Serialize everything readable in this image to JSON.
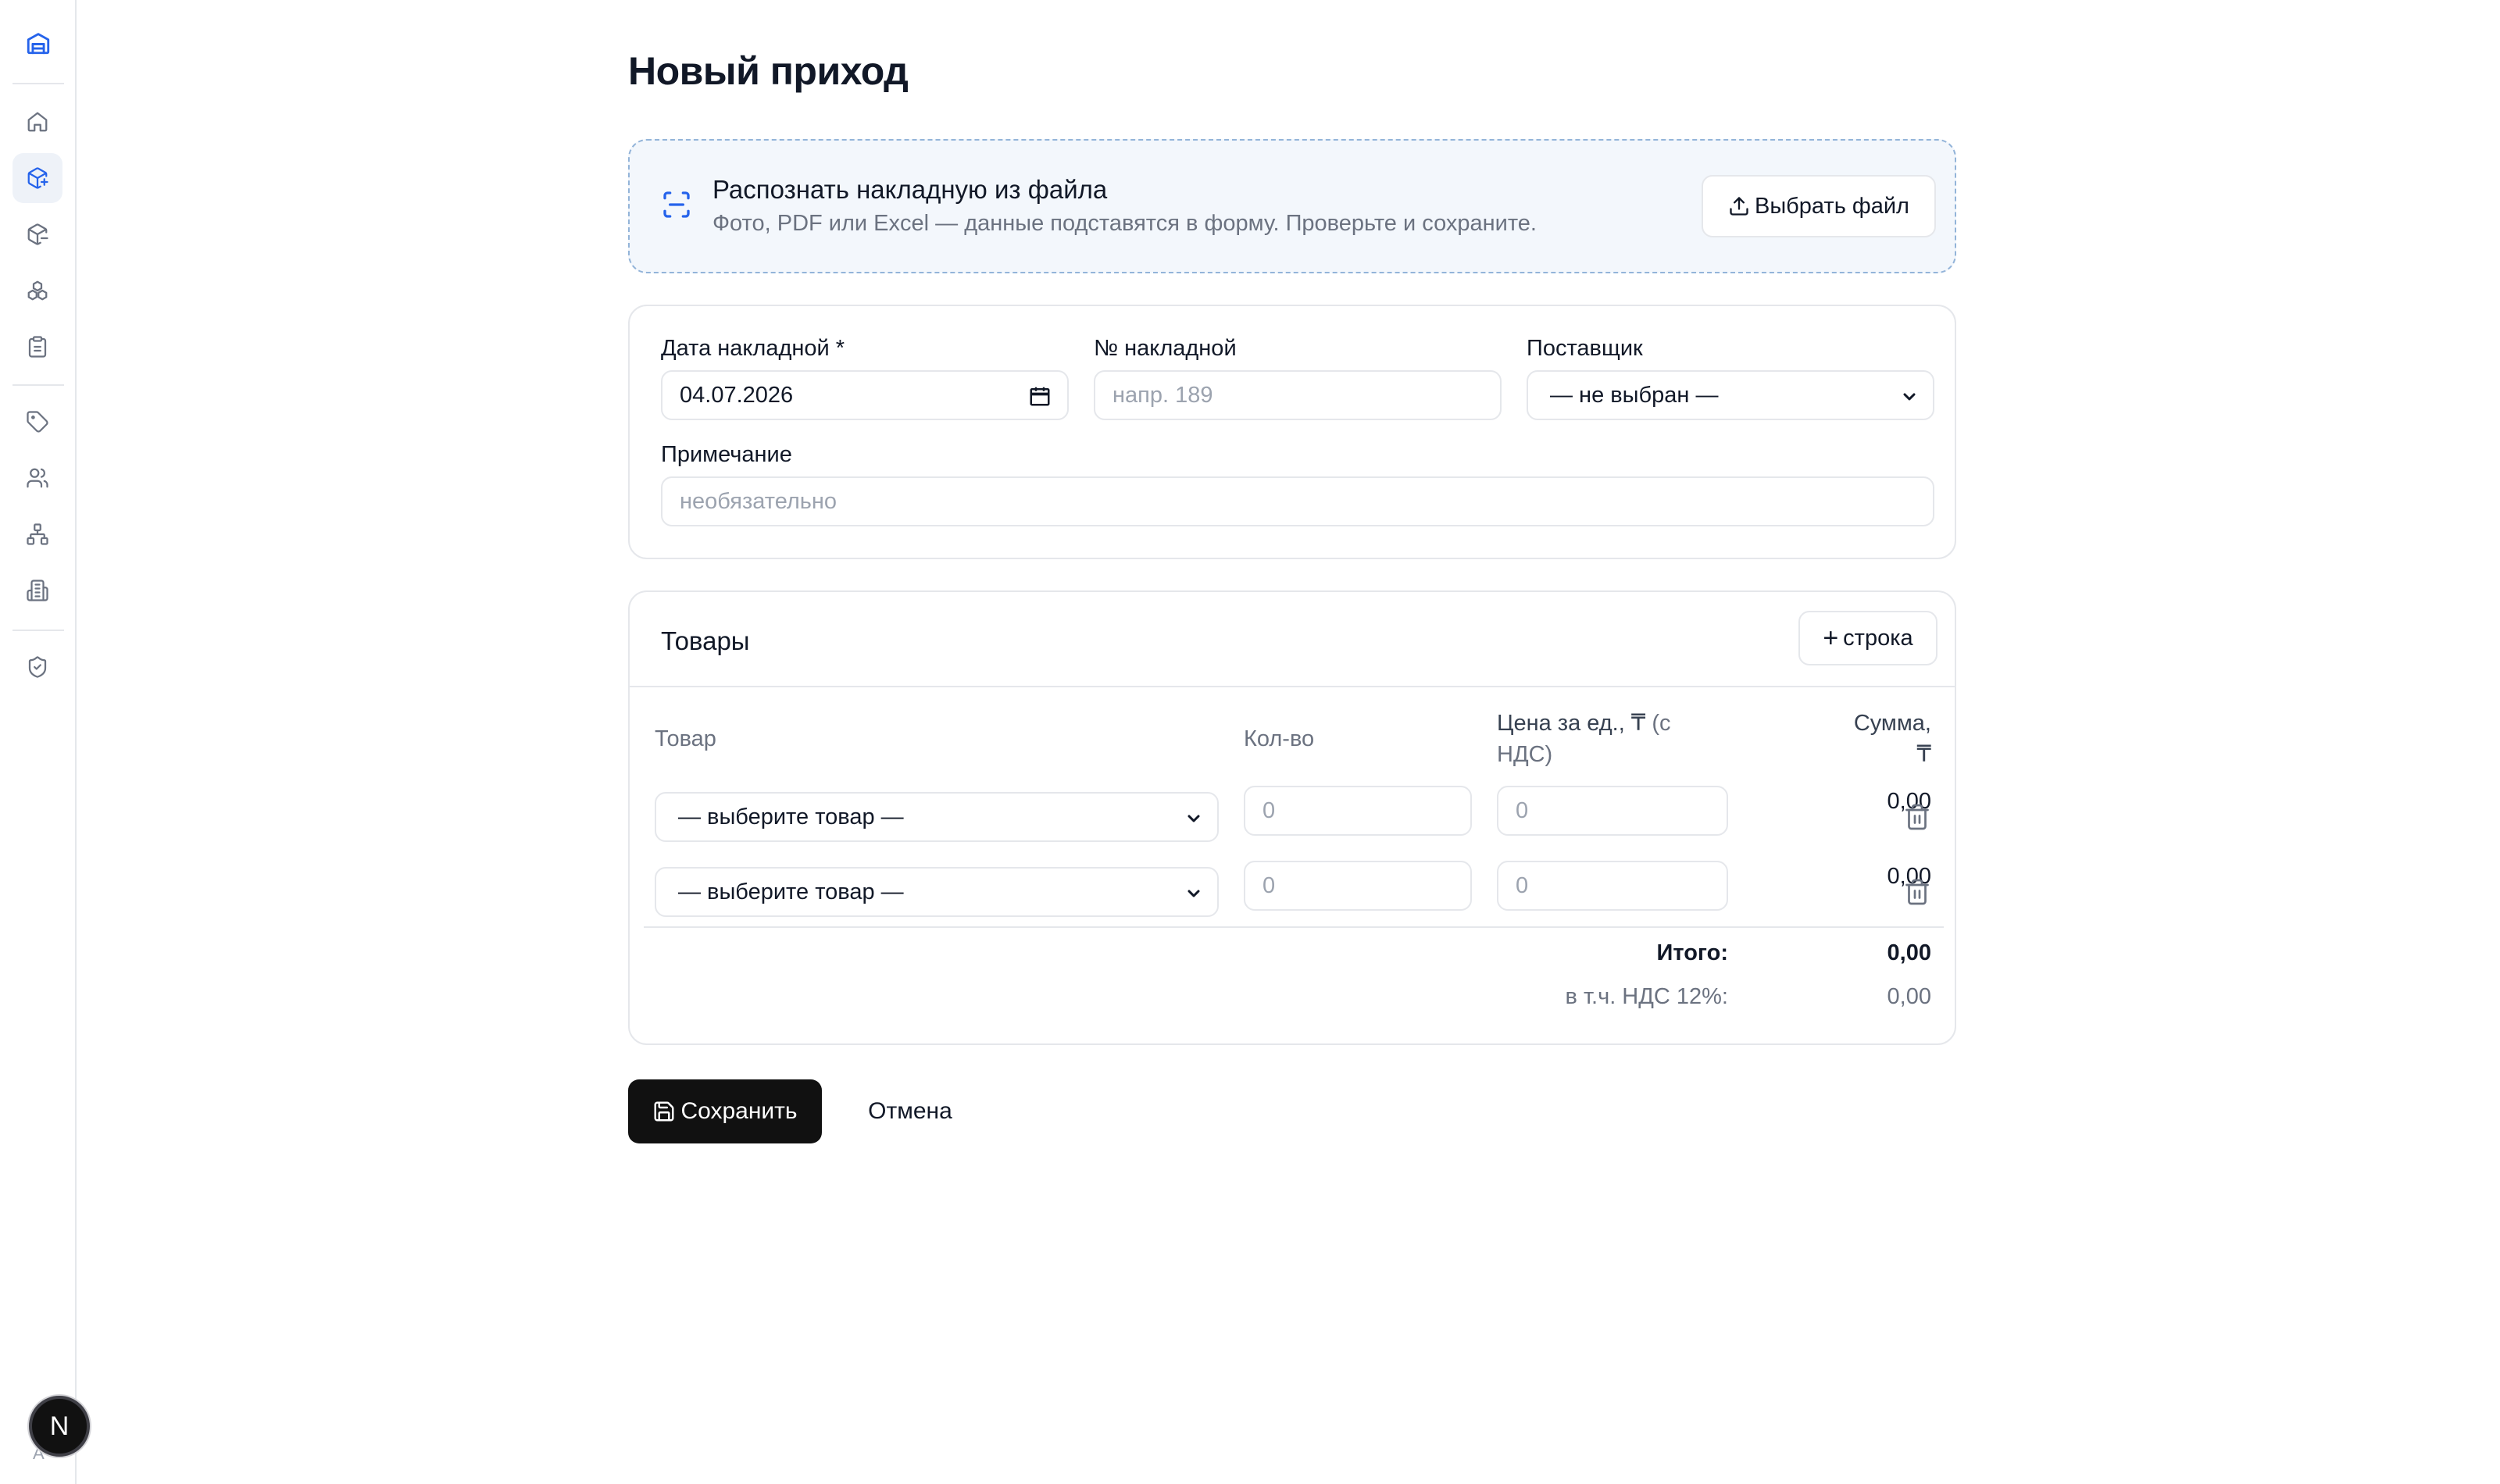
{
  "page": {
    "title": "Новый приход"
  },
  "sidebar": {
    "items": [
      {
        "icon": "home-icon"
      },
      {
        "icon": "package-plus-icon",
        "active": true
      },
      {
        "icon": "package-minus-icon"
      },
      {
        "icon": "boxes-icon"
      },
      {
        "icon": "clipboard-icon"
      },
      {
        "icon": "tag-icon"
      },
      {
        "icon": "users-icon"
      },
      {
        "icon": "network-icon"
      },
      {
        "icon": "building-icon"
      },
      {
        "icon": "shield-check-icon"
      }
    ],
    "avatar_letter": "N",
    "avatar_small": "A"
  },
  "upload": {
    "title": "Распознать накладную из файла",
    "subtitle": "Фото, PDF или Excel — данные подставятся в форму. Проверьте и сохраните.",
    "button_label": "Выбрать файл"
  },
  "form": {
    "date_label": "Дата накладной *",
    "date_value": "04.07.2026",
    "number_label": "№ накладной",
    "number_placeholder": "напр. 189",
    "supplier_label": "Поставщик",
    "supplier_value": "— не выбран —",
    "note_label": "Примечание",
    "note_placeholder": "необязательно"
  },
  "goods": {
    "title": "Товары",
    "add_row_label": "строка",
    "columns": {
      "product": "Товар",
      "qty": "Кол-во",
      "price_line1": "Цена за ед., ₸ (с",
      "price_line2": "НДС)",
      "sum_line1": "Сумма,",
      "sum_line2": "₸"
    },
    "rows": [
      {
        "product": "— выберите товар —",
        "qty_placeholder": "0",
        "price_placeholder": "0",
        "sum": "0,00"
      },
      {
        "product": "— выберите товар —",
        "qty_placeholder": "0",
        "price_placeholder": "0",
        "sum": "0,00"
      }
    ],
    "total_label": "Итого:",
    "total_value": "0,00",
    "vat_label": "в т.ч. НДС 12%:",
    "vat_value": "0,00"
  },
  "actions": {
    "save_label": "Сохранить",
    "cancel_label": "Отмена"
  },
  "colors": {
    "accent": "#2563eb",
    "primary_button": "#111111",
    "upload_bg": "#f3f7fc",
    "upload_border": "#93b4d9"
  }
}
